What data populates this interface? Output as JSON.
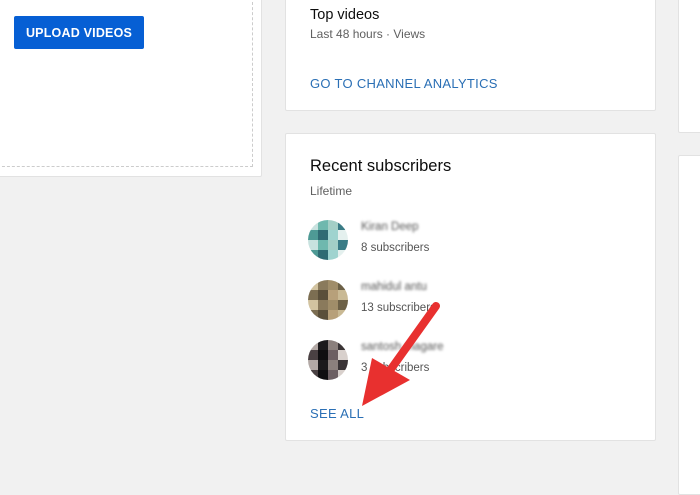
{
  "upload": {
    "button_label": "UPLOAD VIDEOS"
  },
  "top_videos": {
    "title": "Top videos",
    "subtitle": "Last 48 hours · Views",
    "analytics_link": "GO TO CHANNEL ANALYTICS"
  },
  "recent_subscribers": {
    "title": "Recent subscribers",
    "subtitle": "Lifetime",
    "items": [
      {
        "name": "Kiran Deep",
        "count": "8 subscribers"
      },
      {
        "name": "mahidul antu",
        "count": "13 subscribers"
      },
      {
        "name": "santosh magare",
        "count": "3 subscribers"
      }
    ],
    "see_all": "SEE ALL"
  },
  "colors": {
    "primary_button": "#065fd4",
    "link": "#2a6fb5",
    "annotation_arrow": "#e8302f",
    "avatar_1": [
      "#6fb8ae",
      "#9fd3cf",
      "#3a7c86",
      "#c8e2df",
      "#2f6b73",
      "#a3cfc6",
      "#e4f0ee",
      "#4e9a95"
    ],
    "avatar_2": [
      "#8a7a5c",
      "#b7a07a",
      "#6d6147",
      "#d2c3a0",
      "#5a4f3a",
      "#a08d69",
      "#c9b994",
      "#7c6e52"
    ],
    "avatar_3": [
      "#1c1a1c",
      "#6c5f62",
      "#3a3436",
      "#b3a9a6",
      "#0f0e10",
      "#8b807d",
      "#d8d0cc",
      "#4a4143"
    ]
  }
}
